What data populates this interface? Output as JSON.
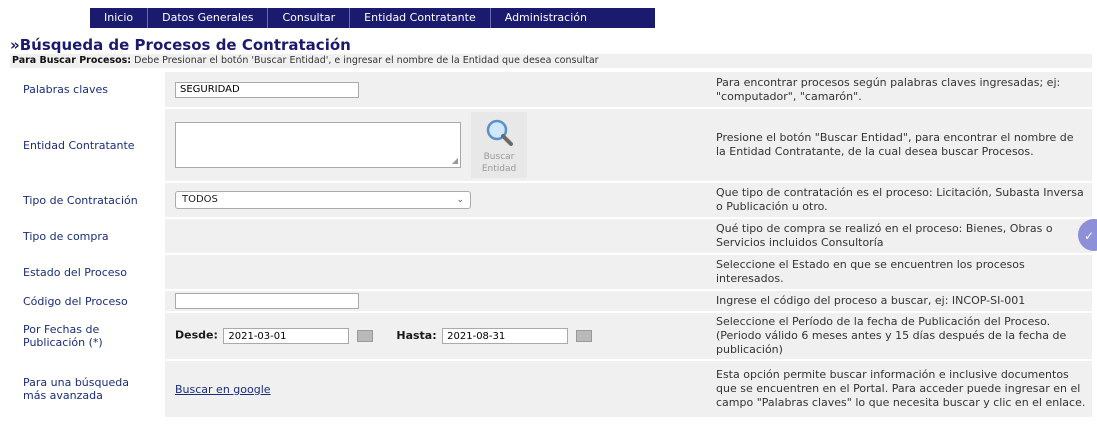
{
  "nav": {
    "items": [
      "Inicio",
      "Datos Generales",
      "Consultar",
      "Entidad Contratante",
      "Administración"
    ]
  },
  "page": {
    "title_prefix": "»",
    "title": "Búsqueda de Procesos de Contratación",
    "hint_bold": "Para Buscar Procesos:",
    "hint_text": " Debe Presionar el botón 'Buscar Entidad', e ingresar el nombre de la Entidad que desea consultar"
  },
  "form": {
    "palabras": {
      "label": "Palabras claves",
      "value": "SEGURIDAD",
      "help": "Para encontrar procesos según palabras claves ingresadas; ej: \"computador\", \"camarón\"."
    },
    "entidad": {
      "label": "Entidad Contratante",
      "button_line1": "Buscar",
      "button_line2": "Entidad",
      "help": "Presione el botón \"Buscar Entidad\", para encontrar el nombre de la Entidad Contratante, de la cual desea buscar Procesos."
    },
    "tipo_contratacion": {
      "label": "Tipo de Contratación",
      "selected": "TODOS",
      "help": "Que tipo de contratación es el proceso: Licitación, Subasta Inversa o Publicación u otro."
    },
    "tipo_compra": {
      "label": "Tipo de compra",
      "help": "Qué tipo de compra se realizó en el proceso: Bienes, Obras o Servicios incluidos Consultoría"
    },
    "estado": {
      "label": "Estado del Proceso",
      "help": "Seleccione el Estado en que se encuentren los procesos interesados."
    },
    "codigo": {
      "label": "Código del Proceso",
      "value": "",
      "help": "Ingrese el código del proceso a buscar, ej: INCOP-SI-001"
    },
    "fechas": {
      "label_line1": "Por Fechas de",
      "label_line2": "Publicación (*)",
      "desde_label": "Desde:",
      "desde_value": "2021-03-01",
      "hasta_label": "Hasta:",
      "hasta_value": "2021-08-31",
      "help": "Seleccione el Período de la fecha de Publicación del Proceso. (Periodo válido 6 meses antes y 15 días después de la fecha de publicación)"
    },
    "avanzada": {
      "label_line1": "Para una búsqueda",
      "label_line2": "más avanzada",
      "link": "Buscar en google",
      "help": "Esta opción permite buscar información e inclusive documentos que se encuentren en el Portal. Para acceder puede ingresar en el campo \"Palabras claves\" lo que necesita buscar y clic en el enlace."
    }
  },
  "icons": {
    "search": "magnifier-icon",
    "calendar": "calendar-icon",
    "chevron": "chevron-down-icon",
    "float": "chat-icon"
  },
  "colors": {
    "nav_bg": "#1a1a6e",
    "label": "#1a2d7a",
    "row_bg": "#f0f0f0",
    "float": "#8d8fd8"
  }
}
